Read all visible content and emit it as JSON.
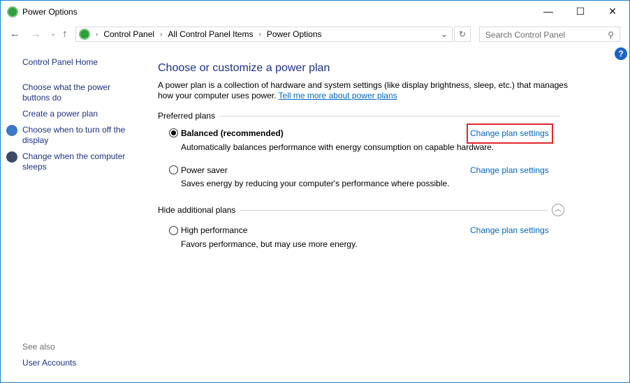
{
  "window": {
    "title": "Power Options",
    "minimize": "—",
    "maximize": "☐",
    "close": "✕"
  },
  "nav": {
    "back": "←",
    "forward": "→",
    "recent": "⌄",
    "up": "↑",
    "refresh": "↻",
    "dropdown": "⌄"
  },
  "breadcrumb": [
    "Control Panel",
    "All Control Panel Items",
    "Power Options"
  ],
  "search": {
    "placeholder": "Search Control Panel",
    "icon": "⚲"
  },
  "help": "?",
  "sidebar": {
    "home": "Control Panel Home",
    "items": [
      "Choose what the power buttons do",
      "Create a power plan",
      "Choose when to turn off the display",
      "Change when the computer sleeps"
    ],
    "see_also": "See also",
    "user_accounts": "User Accounts"
  },
  "main": {
    "title": "Choose or customize a power plan",
    "description": "A power plan is a collection of hardware and system settings (like display brightness, sleep, etc.) that manages how your computer uses power.",
    "tell_more": "Tell me more about power plans",
    "preferred": "Preferred plans",
    "hide_additional": "Hide additional plans",
    "collapse_icon": "︿",
    "plans": [
      {
        "name": "Balanced (recommended)",
        "desc": "Automatically balances performance with energy consumption on capable hardware.",
        "link": "Change plan settings",
        "selected": true
      },
      {
        "name": "Power saver",
        "desc": "Saves energy by reducing your computer's performance where possible.",
        "link": "Change plan settings",
        "selected": false
      },
      {
        "name": "High performance",
        "desc": "Favors performance, but may use more energy.",
        "link": "Change plan settings",
        "selected": false
      }
    ]
  }
}
